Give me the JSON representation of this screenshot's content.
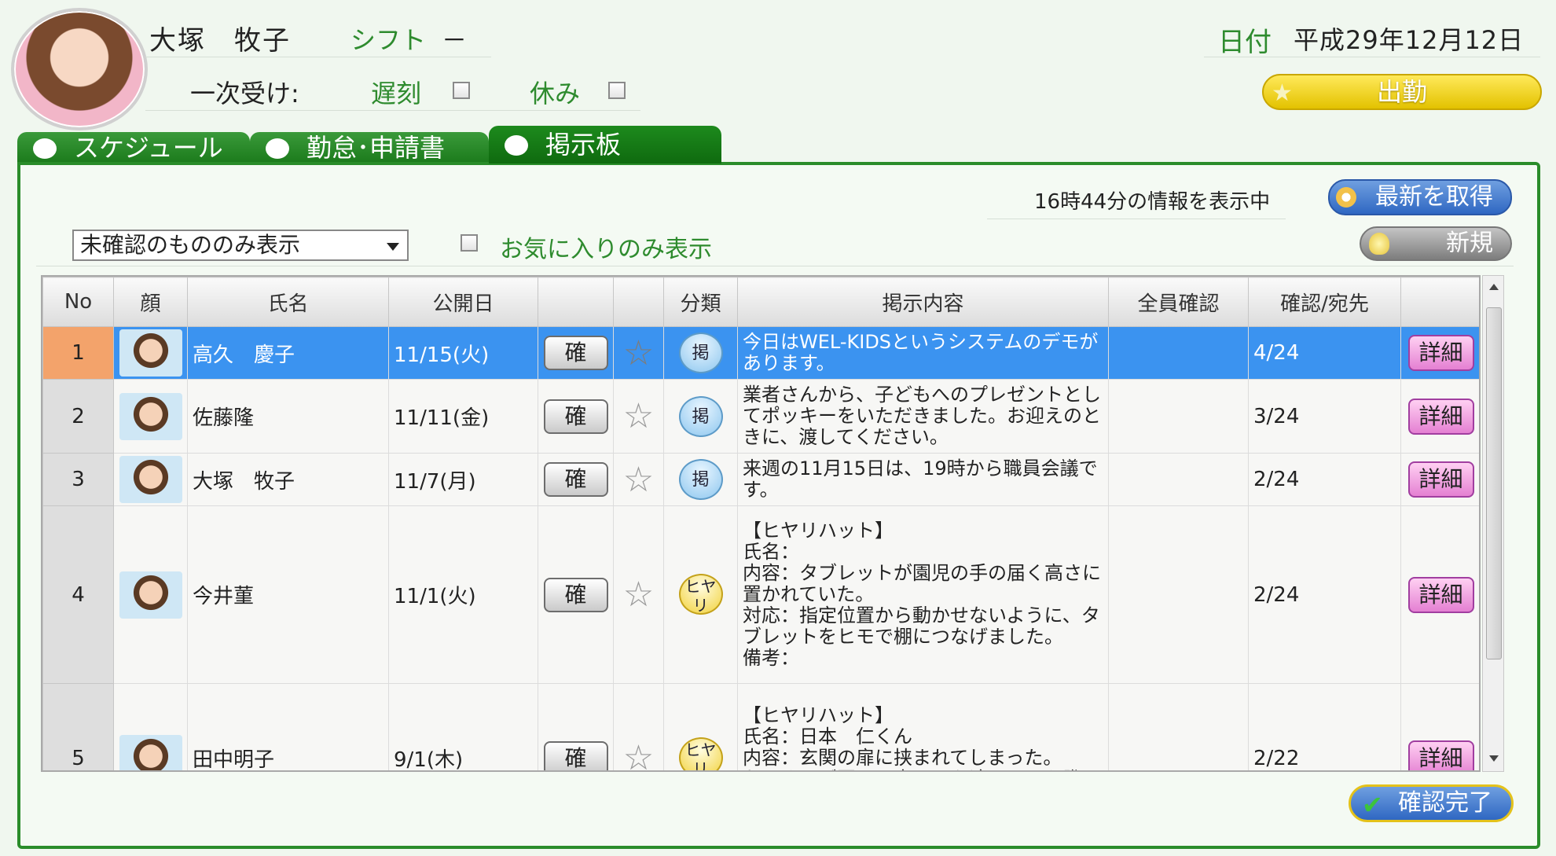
{
  "header": {
    "user_name": "大塚　牧子",
    "shift_label": "シフト",
    "shift_value": "－",
    "first_receive_label": "一次受け:",
    "late_label": "遅刻",
    "rest_label": "休み",
    "date_label": "日付",
    "date_value": "平成29年12月12日",
    "attend_button": "出勤"
  },
  "tabs": [
    {
      "label": "スケジュール"
    },
    {
      "label": "勤怠･申請書"
    },
    {
      "label": "掲示板"
    }
  ],
  "board": {
    "info_text": "16時44分の情報を表示中",
    "refresh_button": "最新を取得",
    "new_button": "新規",
    "filter_value": "未確認のもののみ表示",
    "favorites_label": "お気に入りのみ表示",
    "columns": [
      "No",
      "顔",
      "氏名",
      "公開日",
      "",
      "",
      "分類",
      "掲示内容",
      "全員確認",
      "確認/宛先",
      ""
    ],
    "confirm_label": "確",
    "detail_label": "詳細",
    "rows": [
      {
        "no": "1",
        "name": "高久　慶子",
        "date": "11/15(火)",
        "category": "掲",
        "content": "今日はWEL-KIDSというシステムのデモがあります。",
        "all_confirm": "",
        "ratio": "4/24"
      },
      {
        "no": "2",
        "name": "佐藤隆",
        "date": "11/11(金)",
        "category": "掲",
        "content": "業者さんから、子どもへのプレゼントとしてポッキーをいただきました。お迎えのときに、渡してください。",
        "all_confirm": "",
        "ratio": "3/24"
      },
      {
        "no": "3",
        "name": "大塚　牧子",
        "date": "11/7(月)",
        "category": "掲",
        "content": "来週の11月15日は、19時から職員会議です。",
        "all_confirm": "",
        "ratio": "2/24"
      },
      {
        "no": "4",
        "name": "今井菫",
        "date": "11/1(火)",
        "category": "ヒヤリ",
        "content": "【ヒヤリハット】\n氏名：\n内容：タブレットが園児の手の届く高さに置かれていた。\n対応：指定位置から動かせないように、タブレットをヒモで棚につなげました。\n備考：",
        "all_confirm": "",
        "ratio": "2/24"
      },
      {
        "no": "5",
        "name": "田中明子",
        "date": "9/1(木)",
        "category": "ヒヤリ",
        "content": "【ヒヤリハット】\n氏名：日本　仁くん\n内容：玄関の扉に挟まれてしまった。\nお母さんが園から出るのを追いかけた際に、自分で扉を開けず体を挟まれ",
        "all_confirm": "",
        "ratio": "2/22"
      }
    ]
  },
  "confirm_done_button": "確認完了",
  "colors": {
    "accent_green": "#2a8c2a",
    "selected_row": "#3b93f0",
    "detail_pink": "#e480d2"
  }
}
